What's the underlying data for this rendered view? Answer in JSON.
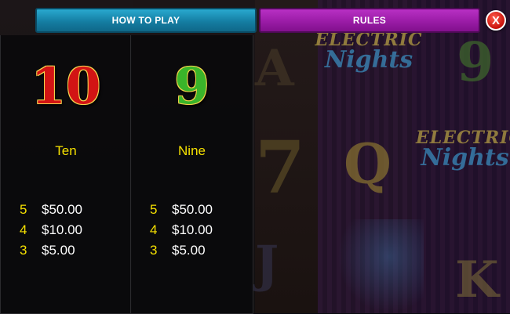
{
  "tabs": {
    "how_to_play": "HOW TO PLAY",
    "rules": "RULES",
    "close_glyph": "X",
    "how_to_play_color": "#1a8db5",
    "rules_color": "#a020b0",
    "close_color": "#d8170f"
  },
  "background": {
    "logos": [
      {
        "line1": "ELECTRIC",
        "line2": "Nights"
      },
      {
        "line1": "ELECTRIC",
        "line2": "Nights"
      }
    ],
    "symbols": [
      "A",
      "7",
      "Q",
      "9",
      "K",
      "J"
    ]
  },
  "paytable": [
    {
      "symbol": "10",
      "name": "Ten",
      "symbol_color": "#d21414",
      "pays": [
        {
          "count": "5",
          "amount": "$50.00"
        },
        {
          "count": "4",
          "amount": "$10.00"
        },
        {
          "count": "3",
          "amount": "$5.00"
        }
      ]
    },
    {
      "symbol": "9",
      "name": "Nine",
      "symbol_color": "#3ab42a",
      "pays": [
        {
          "count": "5",
          "amount": "$50.00"
        },
        {
          "count": "4",
          "amount": "$10.00"
        },
        {
          "count": "3",
          "amount": "$5.00"
        }
      ]
    }
  ]
}
